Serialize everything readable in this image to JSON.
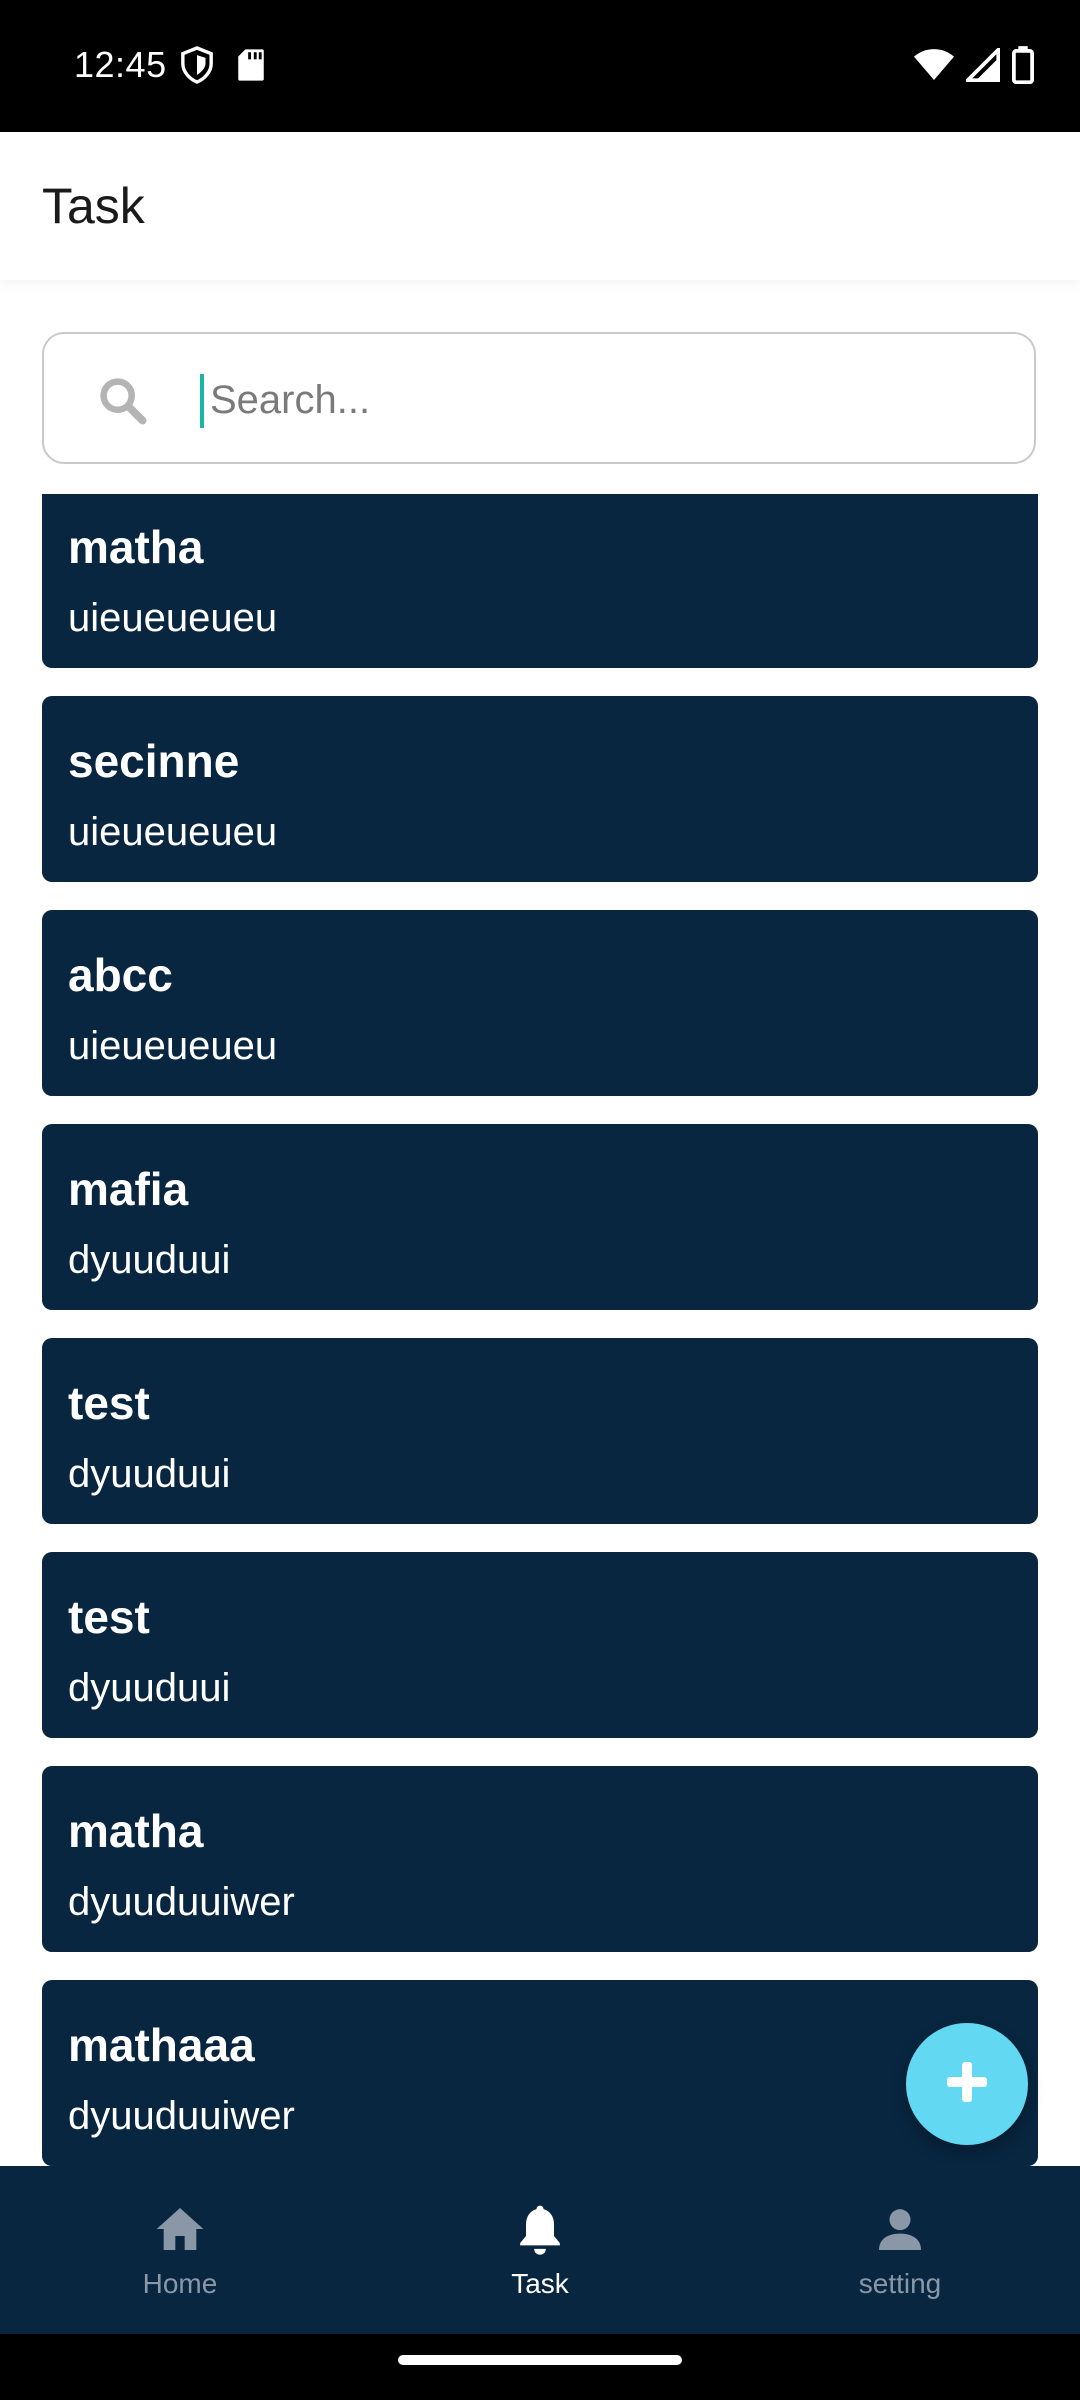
{
  "status_bar": {
    "time": "12:45"
  },
  "app_bar": {
    "title": "Task"
  },
  "search": {
    "placeholder": "Search...",
    "value": ""
  },
  "tasks": [
    {
      "title": "matha",
      "description": "uieueueueu"
    },
    {
      "title": "secinne",
      "description": "uieueueueu"
    },
    {
      "title": "abcc",
      "description": "uieueueueu"
    },
    {
      "title": "mafia",
      "description": "dyuuduui"
    },
    {
      "title": "test",
      "description": "dyuuduui"
    },
    {
      "title": "test",
      "description": "dyuuduui"
    },
    {
      "title": "matha",
      "description": "dyuuduuiwer"
    },
    {
      "title": "mathaaa",
      "description": "dyuuduuiwer"
    }
  ],
  "fab": {
    "icon": "plus-icon"
  },
  "bottom_nav": {
    "items": [
      {
        "label": "Home",
        "icon": "home-icon",
        "active": false
      },
      {
        "label": "Task",
        "icon": "bell-icon",
        "active": true
      },
      {
        "label": "setting",
        "icon": "person-icon",
        "active": false
      }
    ]
  },
  "colors": {
    "card": "#082640",
    "nav": "#082640",
    "fab": "#62d8f3",
    "nav_inactive": "#8a97a6",
    "nav_active": "#ffffff",
    "caret": "#19b6a8"
  }
}
